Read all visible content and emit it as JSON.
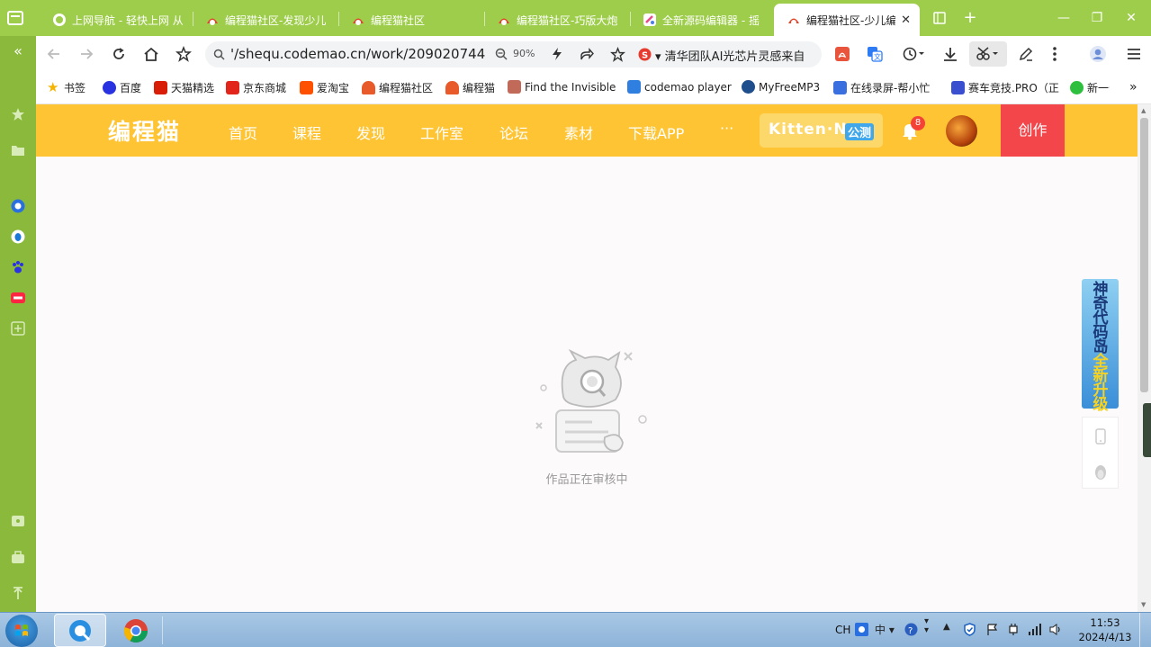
{
  "tabs": [
    {
      "title": "上网导航 - 轻快上网 从",
      "icon": "browser-q-icon",
      "active": false
    },
    {
      "title": "编程猫社区-发现少儿",
      "icon": "codemao-icon",
      "active": false
    },
    {
      "title": "编程猫社区",
      "icon": "codemao-icon",
      "active": false
    },
    {
      "title": "编程猫社区-巧版大炮",
      "icon": "codemao-icon",
      "active": false
    },
    {
      "title": "全新源码编辑器 - 摇",
      "icon": "editor-icon",
      "active": false
    },
    {
      "title": "编程猫社区-少儿编",
      "icon": "codemao-icon",
      "active": true
    }
  ],
  "address": {
    "url": "'/shequ.codemao.cn/work/209020744",
    "zoom": "90%",
    "news": "清华团队AI光芯片灵感来自"
  },
  "bookmarks": [
    {
      "label": "书签",
      "color": "#f5b400"
    },
    {
      "label": "百度",
      "color": "#2932e1"
    },
    {
      "label": "天猫精选",
      "color": "#d81e06"
    },
    {
      "label": "京东商城",
      "color": "#e1251b"
    },
    {
      "label": "爱淘宝",
      "color": "#ff5000"
    },
    {
      "label": "编程猫社区",
      "color": "#e85a2a"
    },
    {
      "label": "编程猫",
      "color": "#e85a2a"
    },
    {
      "label": "Find the Invisible",
      "color": "#c26a5a"
    },
    {
      "label": "codemao player",
      "color": "#2f7fe0"
    },
    {
      "label": "MyFreeMP3",
      "color": "#1e4e8c"
    },
    {
      "label": "在线录屏-帮小忙",
      "color": "#3a6fe0"
    },
    {
      "label": "赛车竞技.PRO（正",
      "color": "#3a4fd0"
    },
    {
      "label": "新一号",
      "color": "#2fbf3f"
    }
  ],
  "site": {
    "logo": "编程猫",
    "nav": [
      "首页",
      "课程",
      "发现",
      "工作室",
      "论坛",
      "素材",
      "下载APP",
      "···"
    ],
    "kitten": "Kitten·N",
    "kitten_tag": "公测",
    "notifications": "8",
    "create": "创作"
  },
  "content": {
    "status": "作品正在审核中"
  },
  "ad": {
    "line1": "神奇代码岛",
    "line2": "全新升级"
  },
  "taskbar": {
    "tray_lang": "CH",
    "tray_ime": "中",
    "time": "11:53",
    "date": "2024/4/13"
  }
}
